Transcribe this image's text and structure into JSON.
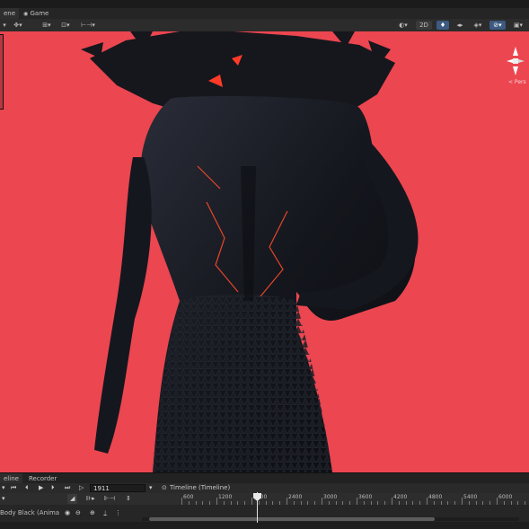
{
  "window": {
    "tabs": [
      {
        "label": "ene",
        "active": true
      },
      {
        "label": "Game",
        "active": false
      }
    ]
  },
  "scene_toolbar": {
    "left_icons": [
      "layers-icon",
      "move-tool-icon",
      "grid-icon",
      "snap-icon",
      "ruler-icon"
    ],
    "right_icons": [
      "shading-mode-icon",
      "2d-toggle",
      "lighting-icon",
      "audio-icon",
      "effects-icon",
      "visibility-icon",
      "camera-icon"
    ],
    "toggle_2d_label": "2D"
  },
  "viewport": {
    "background": "#ec4650",
    "gizmo_label": "< Pers"
  },
  "timeline": {
    "tabs": [
      {
        "label": "eline",
        "active": true
      },
      {
        "label": "Recorder",
        "active": false
      }
    ],
    "frame_value": "1911",
    "title": "Timeline (Timeline)",
    "ruler_labels": [
      "600",
      "1200",
      "1800",
      "2400",
      "3000",
      "3600",
      "4200",
      "4800",
      "5400",
      "6000"
    ],
    "playhead_label": "1800",
    "track_label": "Body Black (Anima",
    "row3_icons": [
      "eye-icon",
      "lock-icon",
      "add-track-icon"
    ]
  },
  "colors": {
    "accent": "#3d5a80",
    "viewport_bg": "#ec4650",
    "panel_bg": "#2a2a2a"
  }
}
